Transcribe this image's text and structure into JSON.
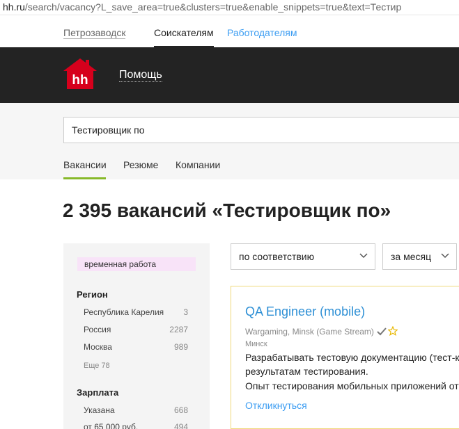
{
  "browser": {
    "url_host": "hh.ru",
    "url_path": "/search/vacancy?L_save_area=true&clusters=true&enable_snippets=true&text=Тестир"
  },
  "topnav": {
    "city": "Петрозаводск",
    "seekers": "Соискателям",
    "employers": "Работодателям"
  },
  "header": {
    "logo_text": "hh",
    "help": "Помощь"
  },
  "search": {
    "value": "Тестировщик по",
    "tabs": [
      "Вакансии",
      "Резюме",
      "Компании"
    ]
  },
  "results": {
    "title": "2 395 вакансий «Тестировщик по»"
  },
  "filters": {
    "tag": "временная работа",
    "region": {
      "title": "Регион",
      "items": [
        {
          "label": "Республика Карелия",
          "count": "3"
        },
        {
          "label": "Россия",
          "count": "2287"
        },
        {
          "label": "Москва",
          "count": "989"
        }
      ],
      "more": "Еще 78"
    },
    "salary": {
      "title": "Зарплата",
      "items": [
        {
          "label": "Указана",
          "count": "668"
        },
        {
          "label": "от 65 000 руб.",
          "count": "494"
        }
      ]
    }
  },
  "sort": {
    "order": "по соответствию",
    "period": "за месяц"
  },
  "vacancy": {
    "title": "QA Engineer (mobile)",
    "company": "Wargaming, Minsk (Game Stream)",
    "city": "Минск",
    "snippet_lines": [
      "Разрабатывать тестовую документацию (тест-к",
      "результатам тестирования.",
      "Опыт тестирования мобильных приложений от"
    ],
    "respond": "Откликнуться"
  },
  "colors": {
    "header_bg": "#232323",
    "logo_red": "#d6001c",
    "link_blue": "#2d8fd5",
    "tab_accent": "#87b929",
    "tag_bg": "#f8e3f8"
  }
}
